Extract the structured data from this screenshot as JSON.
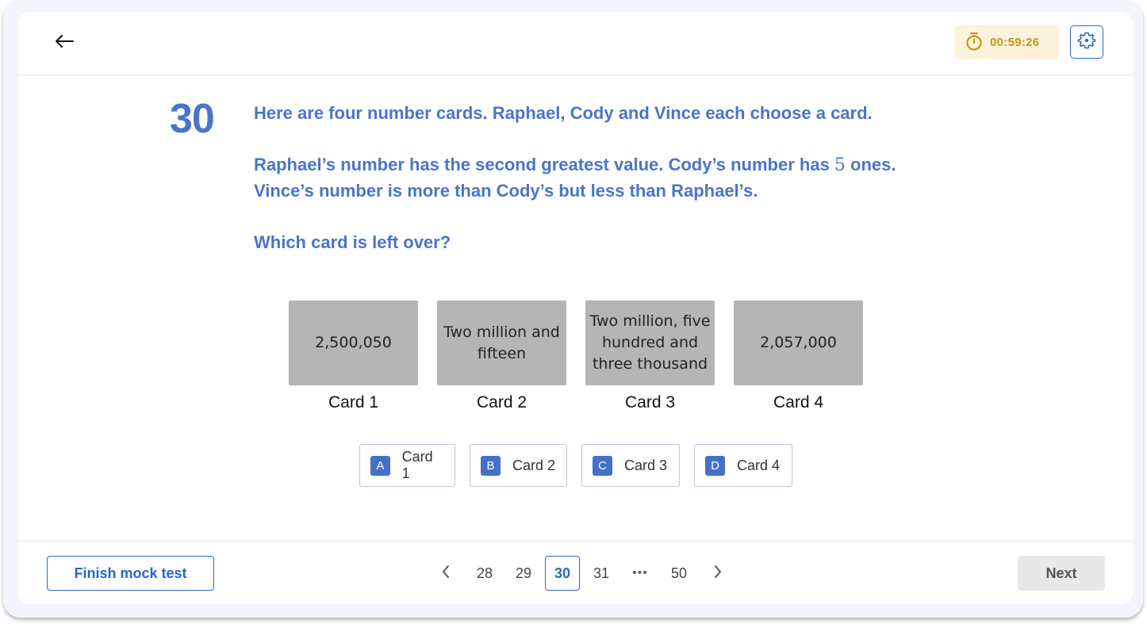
{
  "header": {
    "back_icon": "arrow-left-icon",
    "timer": {
      "icon": "stopwatch-icon",
      "value": "00:59:26"
    },
    "settings_icon": "gear-icon"
  },
  "question": {
    "number": "30",
    "intro": "Here are four number cards. Raphael, Cody and Vince each choose a card.",
    "clue_line1_pre": "Raphael’s number has the second greatest value. Cody’s number has ",
    "clue_line1_math": "5",
    "clue_line1_post": " ones.",
    "clue_line2": "Vince’s number is more than Cody’s but less than Raphael’s.",
    "prompt": "Which card is left over?"
  },
  "cards": [
    {
      "value": "2,500,050",
      "label": "Card 1"
    },
    {
      "value": "Two million and fifteen",
      "label": "Card 2"
    },
    {
      "value": "Two million, five hundred and three thousand",
      "label": "Card 3"
    },
    {
      "value": "2,057,000",
      "label": "Card 4"
    }
  ],
  "options": [
    {
      "letter": "A",
      "text": "Card 1"
    },
    {
      "letter": "B",
      "text": "Card 2"
    },
    {
      "letter": "C",
      "text": "Card 3"
    },
    {
      "letter": "D",
      "text": "Card 4"
    }
  ],
  "footer": {
    "finish_label": "Finish mock test",
    "pagination": {
      "prev_icon": "chevron-left-icon",
      "pages": [
        "28",
        "29",
        "30",
        "31",
        "•••",
        "50"
      ],
      "current": "30",
      "next_icon": "chevron-right-icon"
    },
    "next_label": "Next"
  },
  "colors": {
    "accent": "#2866c4",
    "question_text": "#4b74c9",
    "timer_bg": "#fdf3dd",
    "timer_text": "#c9921a",
    "card_bg": "#b5b5b5",
    "option_badge": "#4470c6"
  }
}
